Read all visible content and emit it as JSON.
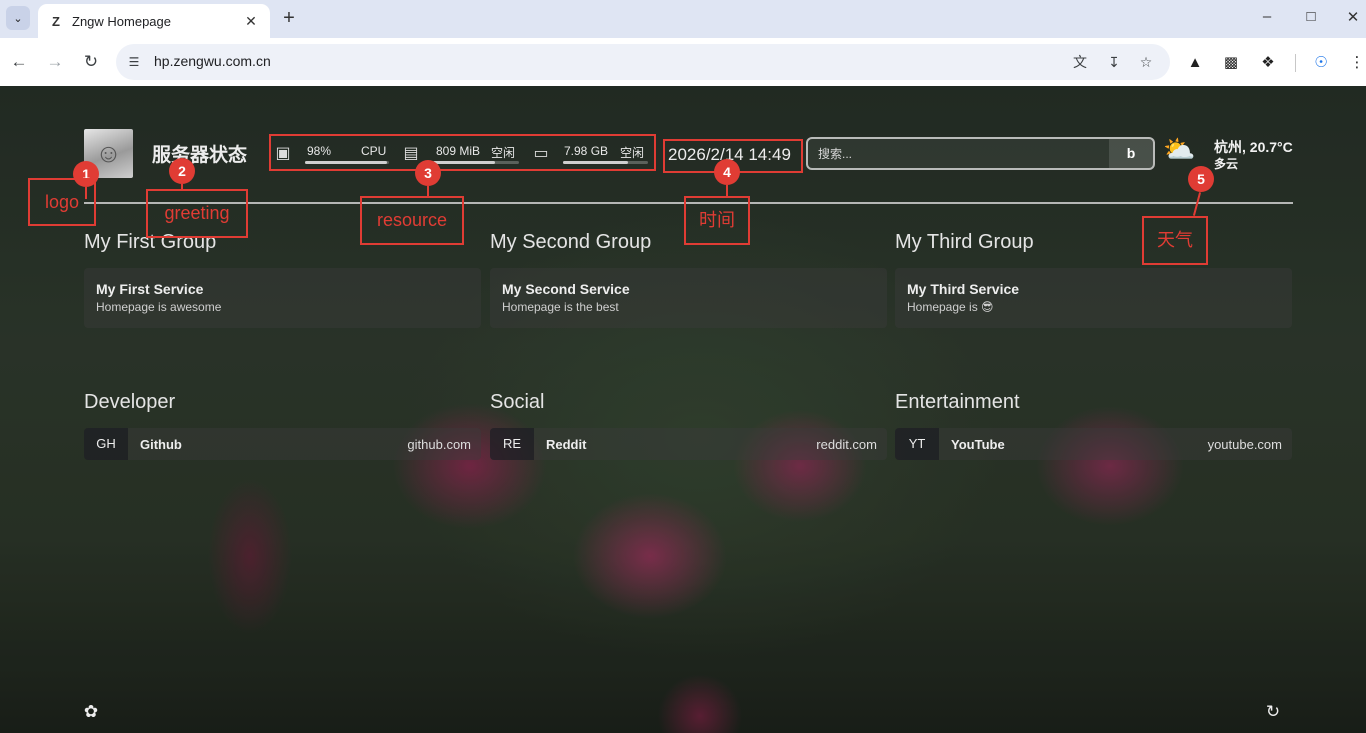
{
  "browser": {
    "tab_title": "Zngw Homepage",
    "tab_favicon": "Z",
    "url": "hp.zengwu.com.cn",
    "icons": [
      "tab-list-icon",
      "close-icon",
      "plus-icon",
      "minimize-icon",
      "maximize-icon",
      "window-close-icon",
      "back-icon",
      "forward-icon",
      "reload-icon",
      "site-info-icon",
      "translate-icon",
      "install-icon",
      "star-icon",
      "extension-a-icon",
      "extension-b-icon",
      "puzzle-icon",
      "profile-icon",
      "menu-icon"
    ]
  },
  "header": {
    "greeting": "服务器状态",
    "resources": {
      "cpu": {
        "value": "98%",
        "label": "CPU",
        "fill": 0.98
      },
      "memory": {
        "value": "809 MiB",
        "label": "空闲",
        "fill": 0.72
      },
      "disk": {
        "value": "7.98 GB",
        "label": "空闲",
        "fill": 0.76
      }
    },
    "datetime": "2026/2/14 14:49",
    "search": {
      "placeholder": "搜索...",
      "button": "b"
    },
    "weather": {
      "location_temp": "杭州, 20.7°C",
      "condition": "多云"
    }
  },
  "service_groups": [
    {
      "title": "My First Group",
      "services": [
        {
          "name": "My First Service",
          "description": "Homepage is awesome"
        }
      ]
    },
    {
      "title": "My Second Group",
      "services": [
        {
          "name": "My Second Service",
          "description": "Homepage is the best"
        }
      ]
    },
    {
      "title": "My Third Group",
      "services": [
        {
          "name": "My Third Service",
          "description": "Homepage is 😎"
        }
      ]
    }
  ],
  "bookmark_groups": [
    {
      "title": "Developer",
      "items": [
        {
          "abbr": "GH",
          "name": "Github",
          "url": "github.com"
        }
      ]
    },
    {
      "title": "Social",
      "items": [
        {
          "abbr": "RE",
          "name": "Reddit",
          "url": "reddit.com"
        }
      ]
    },
    {
      "title": "Entertainment",
      "items": [
        {
          "abbr": "YT",
          "name": "YouTube",
          "url": "youtube.com"
        }
      ]
    }
  ],
  "annotations": [
    {
      "number": "1",
      "label": "logo"
    },
    {
      "number": "2",
      "label": "greeting"
    },
    {
      "number": "3",
      "label": "resource"
    },
    {
      "number": "4",
      "label": "时间"
    },
    {
      "number": "5",
      "label": "天气"
    }
  ],
  "colors": {
    "annotation": "#e03c34"
  }
}
